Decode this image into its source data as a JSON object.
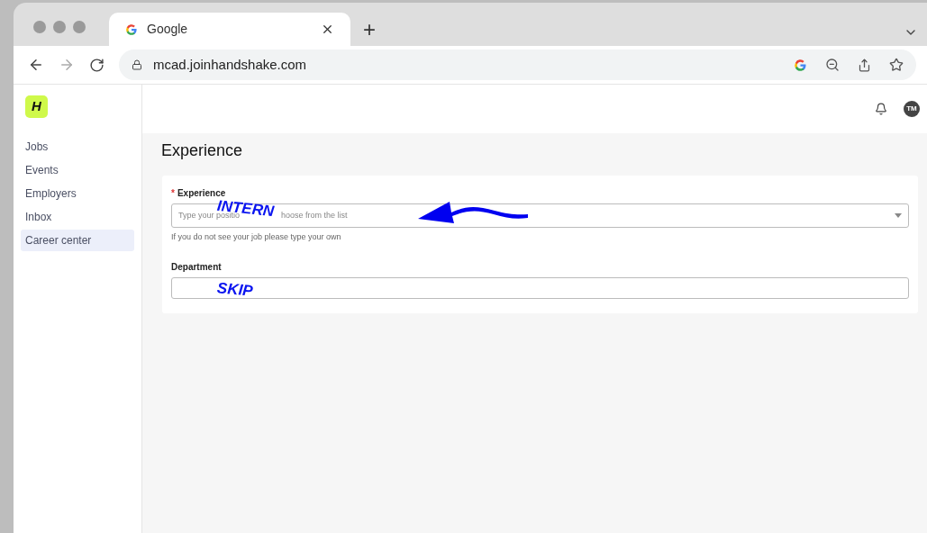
{
  "browser": {
    "tab": {
      "title": "Google"
    },
    "new_tab": "+",
    "url": "mcad.joinhandshake.com"
  },
  "app": {
    "logo": "H",
    "avatar": "TM"
  },
  "sidebar": {
    "items": [
      {
        "label": "Jobs",
        "selected": false
      },
      {
        "label": "Events",
        "selected": false
      },
      {
        "label": "Employers",
        "selected": false
      },
      {
        "label": "Inbox",
        "selected": false
      },
      {
        "label": "Career center",
        "selected": true
      }
    ]
  },
  "page": {
    "title": "Experience"
  },
  "form": {
    "fields": [
      {
        "kind": "dropdown",
        "label": "Experience",
        "required_mark": "*",
        "placeholder_parts": [
          "Type your positio",
          "hoose from the list"
        ],
        "hint": "If you do not see your job please type your own",
        "annotation": "INTERN"
      },
      {
        "kind": "text",
        "label": "Department",
        "annotation": "SKIP"
      }
    ]
  }
}
